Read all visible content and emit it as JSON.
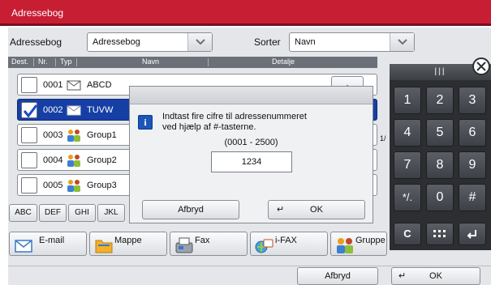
{
  "window": {
    "title": "Adressebog"
  },
  "toolbar": {
    "addressbook_label": "Adressebog",
    "addressbook_value": "Adressebog",
    "sort_label": "Sorter",
    "sort_value": "Navn"
  },
  "columns": {
    "dest": "Dest.",
    "nr": "Nr.",
    "type": "Typ",
    "name": "Navn",
    "detail": "Detalje"
  },
  "rows": [
    {
      "num": "0001",
      "type_icon": "envelope-icon",
      "name": "ABCD",
      "selected": false
    },
    {
      "num": "0002",
      "type_icon": "envelope-icon",
      "name": "TUVW",
      "selected": true
    },
    {
      "num": "0003",
      "type_icon": "group-icon",
      "name": "Group1",
      "selected": false
    },
    {
      "num": "0004",
      "type_icon": "group-icon",
      "name": "Group2",
      "selected": false
    },
    {
      "num": "0005",
      "type_icon": "group-icon",
      "name": "Group3",
      "selected": false
    }
  ],
  "page_indicator": "1/",
  "alpha_tabs": [
    "ABC",
    "DEF",
    "GHI",
    "JKL"
  ],
  "dest_buttons": [
    {
      "label": "E-mail",
      "icon": "email-icon"
    },
    {
      "label": "Mappe",
      "icon": "folder-icon"
    },
    {
      "label": "Fax",
      "icon": "fax-icon"
    },
    {
      "label": "i-FAX",
      "icon": "ifax-icon"
    },
    {
      "label": "Gruppe",
      "icon": "group-icon"
    }
  ],
  "dialog": {
    "message_line1": "Indtast fire cifre til adressenummeret",
    "message_line2": "ved hjælp af #-tasterne.",
    "range": "(0001 - 2500)",
    "value": "1234",
    "cancel": "Afbryd",
    "ok": "OK"
  },
  "keypad": {
    "grip": "|||",
    "keys": [
      "1",
      "2",
      "3",
      "4",
      "5",
      "6",
      "7",
      "8",
      "9",
      "*/.",
      "0",
      "#",
      "C",
      "",
      ""
    ]
  },
  "footer": {
    "cancel": "Afbryd",
    "ok": "OK"
  },
  "colors": {
    "titlebar": "#c81e34",
    "selection": "#163fa5",
    "keypad": "#2c2e32"
  }
}
